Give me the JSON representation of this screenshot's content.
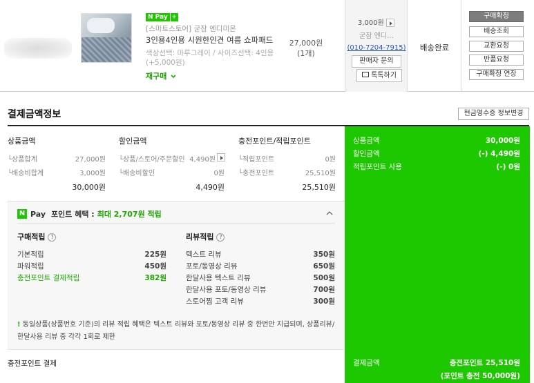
{
  "order": {
    "npay_badge": "N Pay",
    "npay_plus": "+",
    "store": "[스마트스토어] 굳잠 엔디미온",
    "product_name": "3인용4인용 시원한인견 여름 쇼파패드",
    "option": "색상선택: 마루그레이 / 사이즈선택: 4인용",
    "option_extra": "(+5,000원)",
    "rebuy_label": "재구매",
    "price": "27,000원",
    "quantity": "(1개)",
    "shipping_fee": "3,000원",
    "seller": "굳잠 엔디…",
    "seller_phone": "(010-7204-7915)",
    "seller_inquiry": "판매자 문의",
    "talk_button": "톡톡하기",
    "status": "배송완료",
    "actions": [
      "구매확정",
      "배송조회",
      "교환요청",
      "반품요청",
      "구매확정 연장"
    ]
  },
  "payment": {
    "title": "결제금액정보",
    "receipt_button": "현금영수증 정보변경",
    "product_col": {
      "header": "상품금액",
      "items": [
        {
          "label": "└상품합계",
          "value": "27,000원"
        },
        {
          "label": "└배송비합계",
          "value": "3,000원"
        }
      ],
      "total": "30,000원"
    },
    "discount_col": {
      "header": "할인금액",
      "items": [
        {
          "label": "└상품/스토어/주문할인",
          "value": "4,490원"
        },
        {
          "label": "└배송비할인",
          "value": "0원"
        }
      ],
      "total": "4,490원"
    },
    "points_col": {
      "header": "충전포인트/적립포인트",
      "items": [
        {
          "label": "└적립포인트",
          "value": "0원"
        },
        {
          "label": "└충전포인트",
          "value": "25,510원"
        }
      ],
      "total": "25,510원"
    },
    "summary": [
      {
        "label": "상품금액",
        "value": "30,000원"
      },
      {
        "label": "할인금액",
        "value": "(-) 4,490원"
      },
      {
        "label": "적립포인트 사용",
        "value": "(-) 0원"
      }
    ],
    "final": {
      "label": "결제금액",
      "value": "충전포인트 25,510원",
      "sub": "(포인트 충전 50,000원)"
    },
    "method_label": "충전포인트 결제"
  },
  "benefit": {
    "n": "N",
    "pay": "Pay",
    "title": "포인트 혜택 :",
    "max": "최대 2,707원 적립",
    "purchase_header": "구매적립",
    "purchase": [
      {
        "label": "기본적립",
        "value": "225원",
        "highlight": false
      },
      {
        "label": "파워적립",
        "value": "450원",
        "highlight": false
      },
      {
        "label": "충전포인트 결제적립",
        "value": "382원",
        "highlight": true
      }
    ],
    "review_header": "리뷰적립",
    "review": [
      {
        "label": "텍스트 리뷰",
        "value": "350원"
      },
      {
        "label": "포토/동영상 리뷰",
        "value": "650원"
      },
      {
        "label": "한달사용 텍스트 리뷰",
        "value": "500원"
      },
      {
        "label": "한달사용 포토/동영상 리뷰",
        "value": "700원"
      },
      {
        "label": "스토어찜 고객 리뷰",
        "value": "300원"
      }
    ],
    "notice_mark": "!",
    "notice": "동일상품(상품번호 기준)의 리뷰 적립 혜택은 텍스트 리뷰와 포토/동영상 리뷰 중 한번만 지급되며, 상품리뷰/한달사용 리뷰 중 각각 1회로 제한",
    "qmark": "?"
  },
  "colors": {
    "npay_green": "#1ec800",
    "highlight_green": "#1ea500",
    "link_blue": "#2355c9"
  }
}
